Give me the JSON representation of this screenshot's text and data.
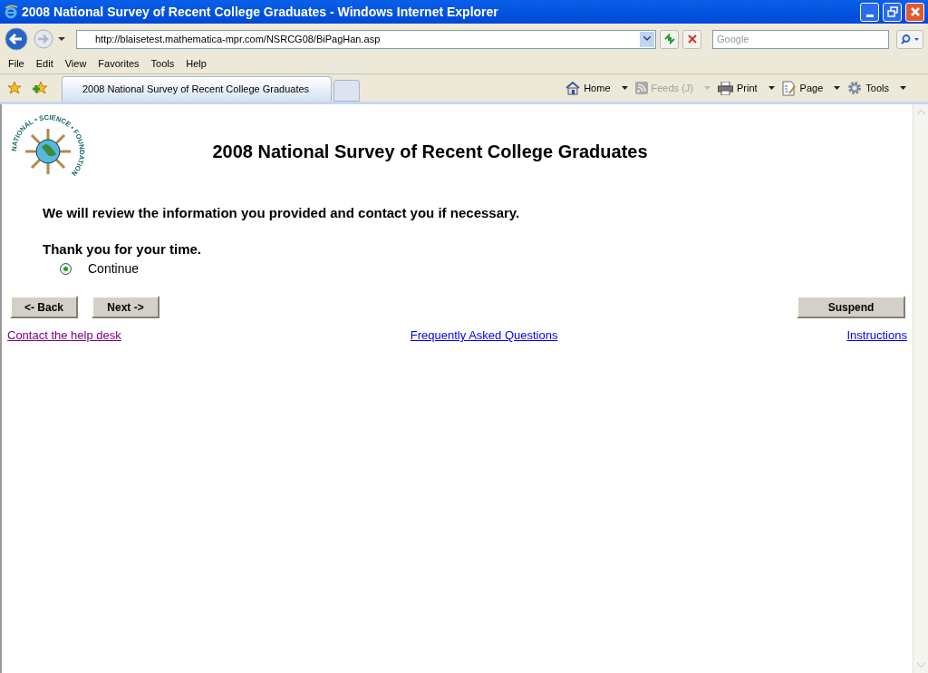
{
  "window": {
    "title": "2008 National Survey of Recent College Graduates - Windows Internet Explorer"
  },
  "address_bar": {
    "url": "http://blaisetest.mathematica-mpr.com/NSRCG08/BiPagHan.asp"
  },
  "search": {
    "placeholder": "Google"
  },
  "menu": [
    "File",
    "Edit",
    "View",
    "Favorites",
    "Tools",
    "Help"
  ],
  "tabs": [
    {
      "label": "2008 National Survey of Recent College Graduates",
      "selected": true
    }
  ],
  "command_bar": [
    {
      "label": "Home",
      "kind": "home",
      "disabled": false
    },
    {
      "label": "Feeds (J)",
      "kind": "feeds",
      "disabled": true
    },
    {
      "label": "Print",
      "kind": "print",
      "disabled": false
    },
    {
      "label": "Page",
      "kind": "page",
      "disabled": false
    },
    {
      "label": "Tools",
      "kind": "tools",
      "disabled": false
    }
  ],
  "page": {
    "logo_text": "NATIONAL • SCIENCE • FOUNDATION",
    "heading": "2008 National Survey of Recent College Graduates",
    "message": "We will review the information you provided and contact you if necessary.",
    "thanks": "Thank you for your time.",
    "options": [
      {
        "label": "Continue",
        "selected": true
      }
    ],
    "buttons": [
      "<- Back",
      "Next ->",
      "Suspend"
    ],
    "links": [
      {
        "label": "Contact the help desk",
        "visited": true
      },
      {
        "label": "Frequently Asked Questions",
        "visited": false
      },
      {
        "label": "Instructions",
        "visited": false
      }
    ]
  }
}
